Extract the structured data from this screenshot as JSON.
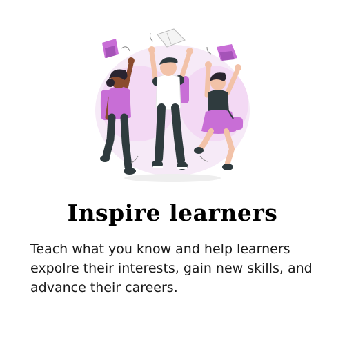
{
  "card": {
    "illustration_name": "jumping-students-illustration",
    "title": "Inspire learners",
    "description": "Teach what you know and help learners expolre their interests, gain new skills, and advance their careers."
  },
  "colors": {
    "accent_purple": "#c86ed6",
    "blob_pink": "#f6e6f7",
    "dark_clothing": "#2f3b3e",
    "skin_dark": "#8a4b2f",
    "skin_light": "#f2c2a8",
    "text": "#1a1a1a"
  }
}
